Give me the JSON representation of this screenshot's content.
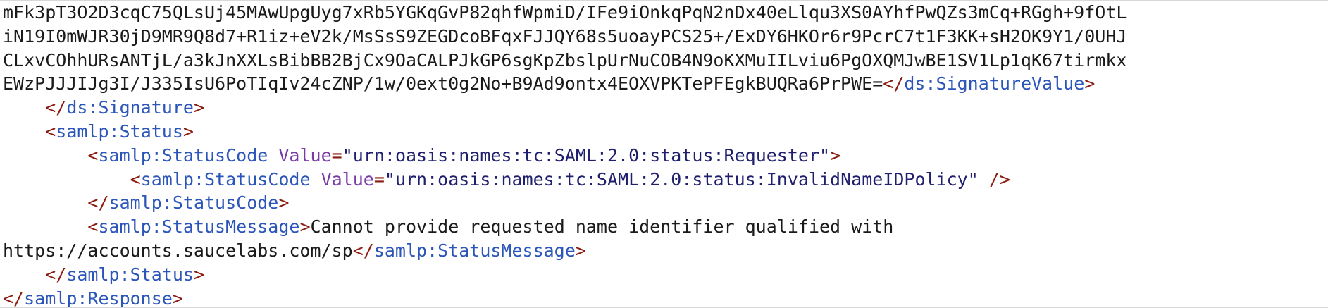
{
  "lines": [
    {
      "indent": "",
      "parts": [
        {
          "t": "txt",
          "v": "mFk3pT3O2D3cqC75QLsUj45MAwUpgUyg7xRb5YGKqGvP82qhfWpmiD/IFe9iOnkqPqN2nDx40eLlqu3XS0AYhfPwQZs3mCq+RGgh+9fOtL"
        }
      ]
    },
    {
      "indent": "",
      "parts": [
        {
          "t": "txt",
          "v": "iN19I0mWJR30jD9MR9Q8d7+R1iz+eV2k/MsSsS9ZEGDcoBFqxFJJQY68s5uoayPCS25+/ExDY6HKOr6r9PcrC7t1F3KK+sH2OK9Y1/0UHJ"
        }
      ]
    },
    {
      "indent": "",
      "parts": [
        {
          "t": "txt",
          "v": "CLxvCOhhURsANTjL/a3kJnXXLsBibBB2BjCx9OaCALPJkGP6sgKpZbslpUrNuCOB4N9oKXMuIILviu6PgOXQMJwBE1SV1Lp1qK67tirmkx"
        }
      ]
    },
    {
      "indent": "",
      "parts": [
        {
          "t": "txt",
          "v": "EWzPJJJIJg3I/J335IsU6PoTIqIv24cZNP/1w/0ext0g2No+B9Ad9ontx4EOXVPKTePFEgkBUQRa6PrPWE="
        },
        {
          "t": "br",
          "v": "</"
        },
        {
          "t": "tag",
          "v": "ds:SignatureValue"
        },
        {
          "t": "br",
          "v": ">"
        }
      ]
    },
    {
      "indent": "    ",
      "parts": [
        {
          "t": "br",
          "v": "</"
        },
        {
          "t": "tag",
          "v": "ds:Signature"
        },
        {
          "t": "br",
          "v": ">"
        }
      ]
    },
    {
      "indent": "    ",
      "parts": [
        {
          "t": "br",
          "v": "<"
        },
        {
          "t": "tag",
          "v": "samlp:Status"
        },
        {
          "t": "br",
          "v": ">"
        }
      ]
    },
    {
      "indent": "        ",
      "parts": [
        {
          "t": "br",
          "v": "<"
        },
        {
          "t": "tag",
          "v": "samlp:StatusCode"
        },
        {
          "t": "txt",
          "v": " "
        },
        {
          "t": "attr",
          "v": "Value"
        },
        {
          "t": "br",
          "v": "="
        },
        {
          "t": "str",
          "v": "\"urn:oasis:names:tc:SAML:2.0:status:Requester\""
        },
        {
          "t": "br",
          "v": ">"
        }
      ]
    },
    {
      "indent": "            ",
      "parts": [
        {
          "t": "br",
          "v": "<"
        },
        {
          "t": "tag",
          "v": "samlp:StatusCode"
        },
        {
          "t": "txt",
          "v": " "
        },
        {
          "t": "attr",
          "v": "Value"
        },
        {
          "t": "br",
          "v": "="
        },
        {
          "t": "str",
          "v": "\"urn:oasis:names:tc:SAML:2.0:status:InvalidNameIDPolicy\""
        },
        {
          "t": "txt",
          "v": " "
        },
        {
          "t": "br",
          "v": "/>"
        }
      ]
    },
    {
      "indent": "        ",
      "parts": [
        {
          "t": "br",
          "v": "</"
        },
        {
          "t": "tag",
          "v": "samlp:StatusCode"
        },
        {
          "t": "br",
          "v": ">"
        }
      ]
    },
    {
      "indent": "        ",
      "parts": [
        {
          "t": "br",
          "v": "<"
        },
        {
          "t": "tag",
          "v": "samlp:StatusMessage"
        },
        {
          "t": "br",
          "v": ">"
        },
        {
          "t": "txt",
          "v": "Cannot provide requested name identifier qualified with"
        }
      ]
    },
    {
      "indent": "",
      "parts": [
        {
          "t": "txt",
          "v": "https://accounts.saucelabs.com/sp"
        },
        {
          "t": "br",
          "v": "</"
        },
        {
          "t": "tag",
          "v": "samlp:StatusMessage"
        },
        {
          "t": "br",
          "v": ">"
        }
      ]
    },
    {
      "indent": "    ",
      "parts": [
        {
          "t": "br",
          "v": "</"
        },
        {
          "t": "tag",
          "v": "samlp:Status"
        },
        {
          "t": "br",
          "v": ">"
        }
      ]
    },
    {
      "indent": "",
      "parts": [
        {
          "t": "br",
          "v": "</"
        },
        {
          "t": "tag",
          "v": "samlp:Response"
        },
        {
          "t": "br",
          "v": ">"
        }
      ]
    }
  ],
  "colors": {
    "tag": "#2b55b8",
    "bracket": "#8a1a10",
    "attribute": "#7a3ba8",
    "string": "#1f1f6e",
    "text": "#1a1a1a",
    "background": "#ffffff"
  }
}
